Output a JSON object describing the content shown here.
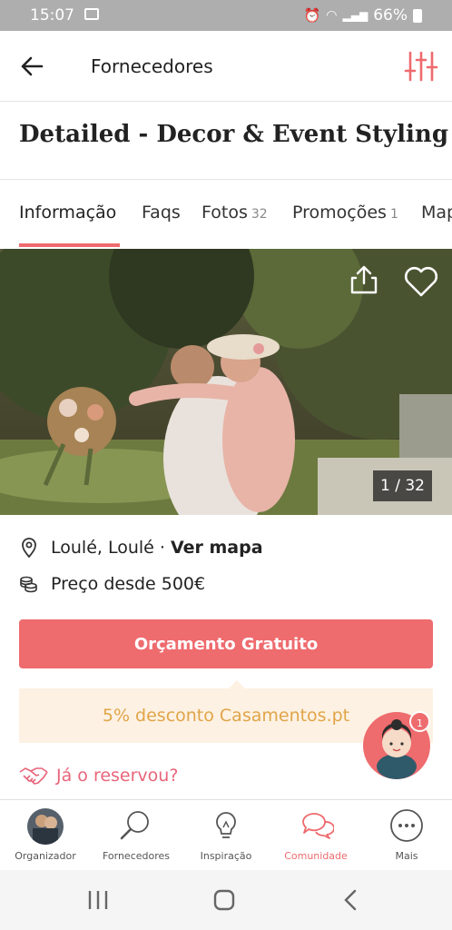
{
  "status_bar": {
    "time": "15:07",
    "battery": "66%"
  },
  "header": {
    "title": "Fornecedores"
  },
  "vendor": {
    "name": "Detailed - Decor & Event Styling"
  },
  "tabs": [
    {
      "label": "Informação",
      "count": ""
    },
    {
      "label": "Faqs",
      "count": ""
    },
    {
      "label": "Fotos",
      "count": "32"
    },
    {
      "label": "Promoções",
      "count": "1"
    },
    {
      "label": "Map",
      "count": ""
    }
  ],
  "gallery": {
    "counter": "1 / 32"
  },
  "info": {
    "location": "Loulé, Loulé ·",
    "map_link": "Ver mapa",
    "price": "Preço desde 500€"
  },
  "cta": {
    "label": "Orçamento Gratuito"
  },
  "promo": {
    "text": "5% desconto Casamentos.pt"
  },
  "reserved": {
    "label": "Já o reservou?"
  },
  "assistant": {
    "badge": "1"
  },
  "bottom_nav": [
    {
      "label": "Organizador",
      "icon": "avatar"
    },
    {
      "label": "Fornecedores",
      "icon": "search-icon"
    },
    {
      "label": "Inspiração",
      "icon": "lightbulb-icon"
    },
    {
      "label": "Comunidade",
      "icon": "chat-icon"
    },
    {
      "label": "Mais",
      "icon": "more-icon"
    }
  ],
  "colors": {
    "accent": "#ee6b6e",
    "promo_bg": "#fdf1e3",
    "promo_text": "#e0a548"
  }
}
